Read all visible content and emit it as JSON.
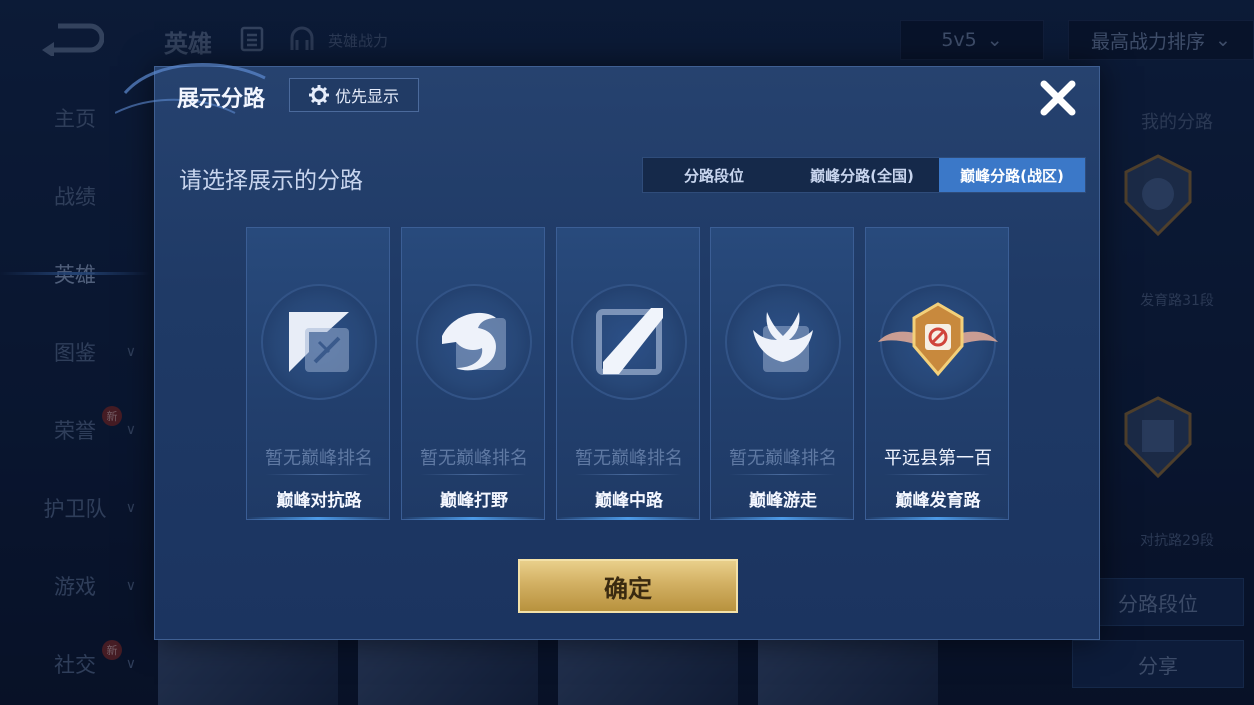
{
  "background": {
    "header": {
      "title": "英雄",
      "sub_label": "英雄战力",
      "mode_dropdown": "5v5",
      "sort_dropdown": "最高战力排序"
    },
    "sidebar": [
      {
        "label": "主页",
        "chevron": false,
        "badge": ""
      },
      {
        "label": "战绩",
        "chevron": false,
        "badge": ""
      },
      {
        "label": "英雄",
        "chevron": false,
        "badge": "",
        "active": true
      },
      {
        "label": "图鉴",
        "chevron": true,
        "badge": ""
      },
      {
        "label": "荣誉",
        "chevron": true,
        "badge": "新"
      },
      {
        "label": "护卫队",
        "chevron": true,
        "badge": ""
      },
      {
        "label": "游戏",
        "chevron": true,
        "badge": ""
      },
      {
        "label": "社交",
        "chevron": true,
        "badge": "新"
      }
    ],
    "right_panel": {
      "title": "我的分路",
      "lane1": "发育路31段",
      "lane2": "对抗路29段",
      "lane_rank_button": "分路段位",
      "share_button": "分享"
    }
  },
  "dialog": {
    "title": "展示分路",
    "priority_button": "优先显示",
    "subtitle": "请选择展示的分路",
    "tabs": [
      {
        "label": "分路段位",
        "active": false
      },
      {
        "label": "巅峰分路(全国)",
        "active": false
      },
      {
        "label": "巅峰分路(战区)",
        "active": true
      }
    ],
    "cards": [
      {
        "lane": "巅峰对抗路",
        "rank": "暂无巅峰排名",
        "icon": "sword-icon",
        "ranked": false
      },
      {
        "lane": "巅峰打野",
        "rank": "暂无巅峰排名",
        "icon": "dragon-icon",
        "ranked": false
      },
      {
        "lane": "巅峰中路",
        "rank": "暂无巅峰排名",
        "icon": "slash-icon",
        "ranked": false
      },
      {
        "lane": "巅峰游走",
        "rank": "暂无巅峰排名",
        "icon": "wings-icon",
        "ranked": false
      },
      {
        "lane": "巅峰发育路",
        "rank": "平远县第一百",
        "icon": "gold-medal-icon",
        "ranked": true
      }
    ],
    "confirm_button": "确定"
  },
  "colors": {
    "accent_tab": "#3b78c8",
    "confirm_gold": "#d2b063",
    "dialog_bg": "#1f3a66"
  }
}
